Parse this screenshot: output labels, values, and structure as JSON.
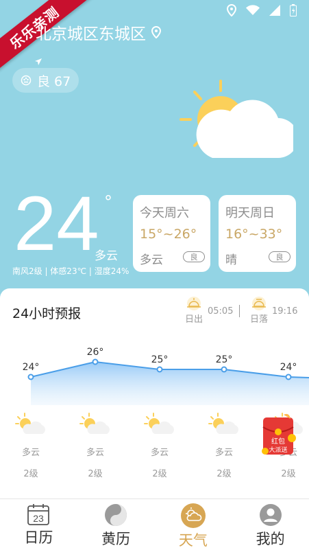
{
  "promo_banner": {
    "text": "乐乐亲测"
  },
  "header": {
    "location": "北京城区东城区",
    "aqi_text": "良 67"
  },
  "current": {
    "temp": "24",
    "deg": "°",
    "condition": "多云",
    "details": "南风2级 | 体感23℃ | 湿度24%"
  },
  "days": [
    {
      "name": "今天周六",
      "range": "15°~26°",
      "cond": "多云",
      "badge": "良"
    },
    {
      "name": "明天周日",
      "range": "16°~33°",
      "cond": "晴",
      "badge": "良"
    }
  ],
  "forecast24": {
    "title": "24小时预报",
    "sunrise_label": "日出",
    "sunrise_time": "05:05",
    "sunset_label": "日落",
    "sunset_time": "19:16",
    "temps": [
      "24°",
      "26°",
      "25°",
      "25°",
      "24°"
    ],
    "conds": [
      "多云",
      "多云",
      "多云",
      "多云",
      "多云"
    ],
    "winds": [
      "2级",
      "2级",
      "2级",
      "2级",
      "2级"
    ]
  },
  "chart_data": {
    "type": "line",
    "x": [
      "1",
      "2",
      "3",
      "4",
      "5"
    ],
    "values": [
      24,
      26,
      25,
      25,
      24
    ]
  },
  "promo": {
    "line1": "红包",
    "line2": "大派送"
  },
  "tabs": [
    {
      "label": "日历",
      "date": "23"
    },
    {
      "label": "黄历"
    },
    {
      "label": "天气"
    },
    {
      "label": "我的"
    }
  ],
  "colors": {
    "sky": "#93d4e4",
    "accent": "#d7a653",
    "temp_range": "#c9a766",
    "line": "#4a9ee8"
  }
}
